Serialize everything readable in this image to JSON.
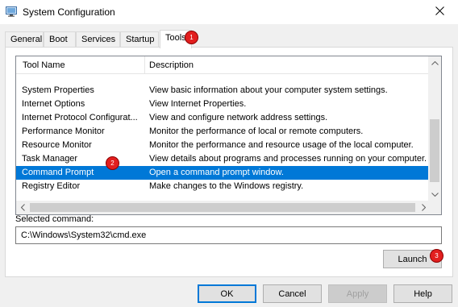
{
  "window": {
    "title": "System Configuration"
  },
  "tabs": [
    {
      "label": "General"
    },
    {
      "label": "Boot"
    },
    {
      "label": "Services"
    },
    {
      "label": "Startup"
    },
    {
      "label": "Tools"
    }
  ],
  "tools": {
    "columns": [
      "Tool Name",
      "Description"
    ],
    "rows": [
      {
        "name": "System Properties",
        "description": "View basic information about your computer system settings."
      },
      {
        "name": "Internet Options",
        "description": "View Internet Properties."
      },
      {
        "name": "Internet Protocol Configurat...",
        "description": "View and configure network address settings."
      },
      {
        "name": "Performance Monitor",
        "description": "Monitor the performance of local or remote computers."
      },
      {
        "name": "Resource Monitor",
        "description": "Monitor the performance and resource usage of the local computer."
      },
      {
        "name": "Task Manager",
        "description": "View details about programs and processes running on your computer."
      },
      {
        "name": "Command Prompt",
        "description": "Open a command prompt window."
      },
      {
        "name": "Registry Editor",
        "description": "Make changes to the Windows registry."
      }
    ],
    "selected_index": 6,
    "selected_command_label": "Selected command:",
    "selected_command": "C:\\Windows\\System32\\cmd.exe",
    "launch_label": "Launch"
  },
  "buttons": {
    "ok": "OK",
    "cancel": "Cancel",
    "apply": "Apply",
    "help": "Help"
  },
  "badges": [
    "1",
    "2",
    "3"
  ],
  "colors": {
    "selection": "#0078d7",
    "badge": "#e21f1f"
  },
  "icons": [
    "system-configuration-icon",
    "close-icon",
    "scroll-up-icon",
    "scroll-down-icon",
    "scroll-left-icon",
    "scroll-right-icon"
  ]
}
